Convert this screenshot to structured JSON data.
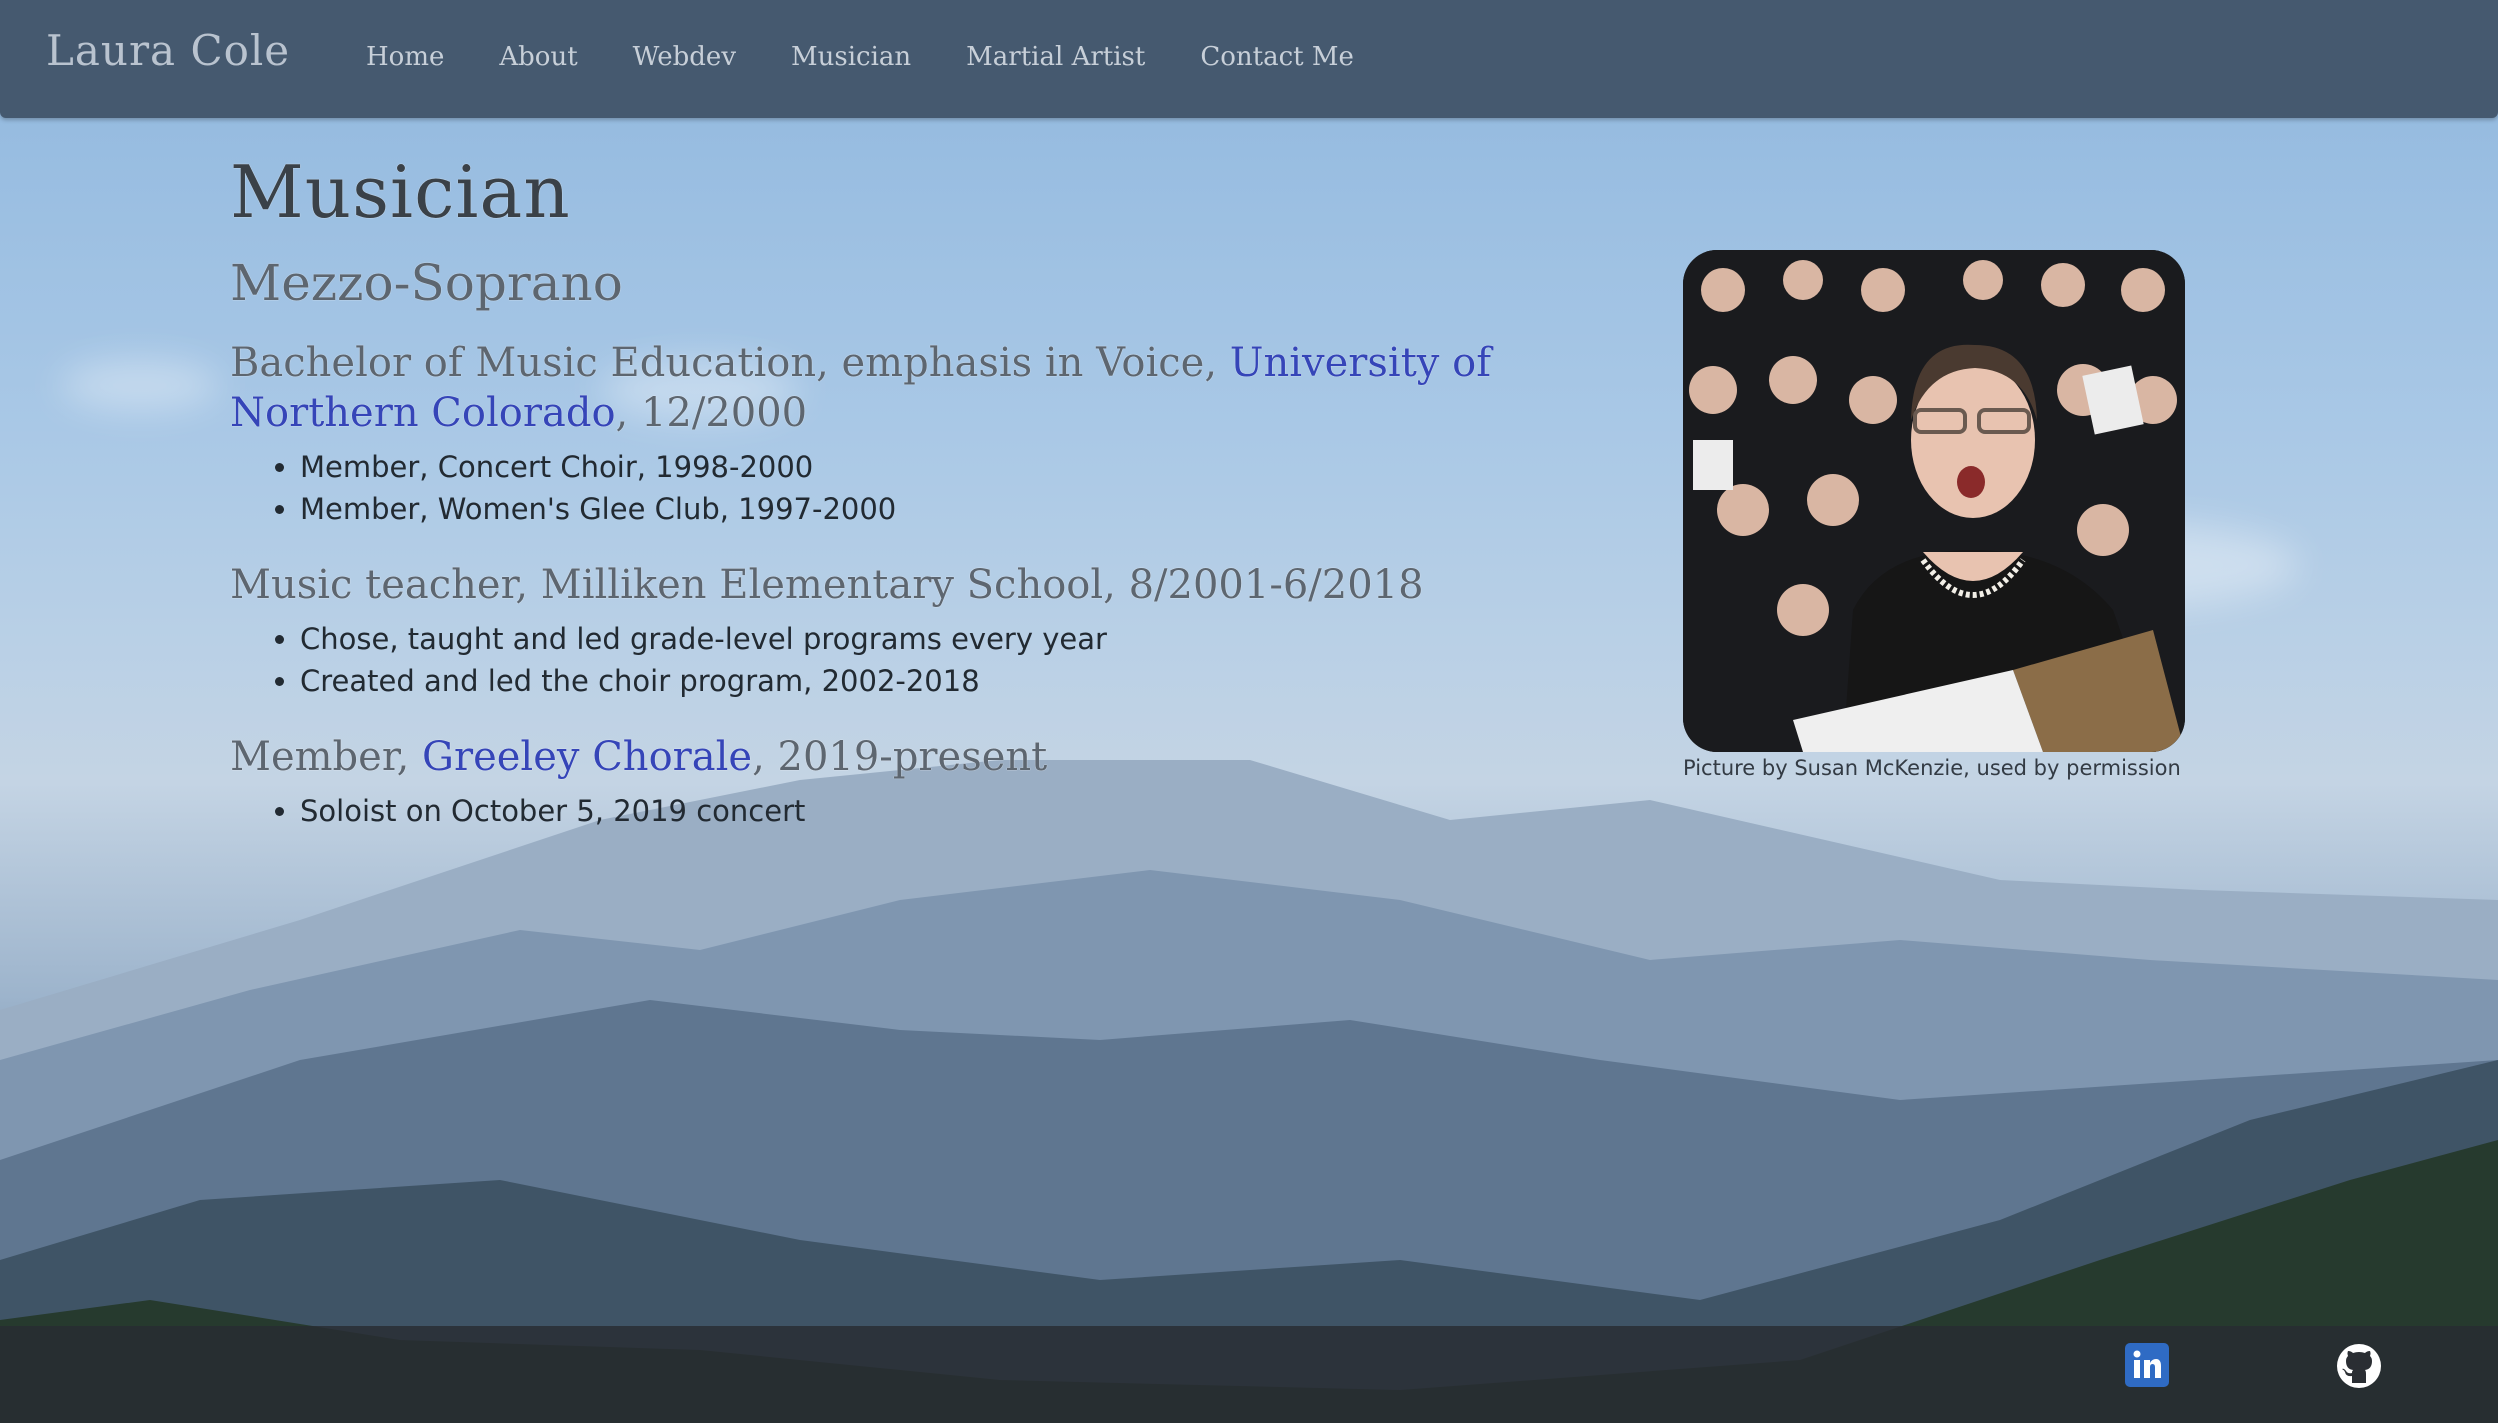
{
  "brand": "Laura Cole",
  "nav": {
    "items": [
      "Home",
      "About",
      "Webdev",
      "Musician",
      "Martial Artist",
      "Contact Me"
    ]
  },
  "page": {
    "title": "Musician",
    "subtitle": "Mezzo-Soprano",
    "sections": [
      {
        "heading_prefix": "Bachelor of Music Education, emphasis in Voice, ",
        "heading_link": "University of Northern Colorado",
        "heading_suffix": ", 12/2000",
        "items": [
          "Member, Concert Choir, 1998-2000",
          "Member, Women's Glee Club, 1997-2000"
        ]
      },
      {
        "heading": "Music teacher, Milliken Elementary School, 8/2001-6/2018",
        "items": [
          "Chose, taught and led grade-level programs every year",
          "Created and led the choir program, 2002-2018"
        ]
      },
      {
        "heading_prefix": "Member, ",
        "heading_link": "Greeley Chorale",
        "heading_suffix": ", 2019-present",
        "items": [
          "Soloist on October 5, 2019 concert"
        ]
      }
    ],
    "photo_caption": "Picture by Susan McKenzie, used by permission"
  },
  "footer": {
    "linkedin_icon": "linkedin-icon",
    "github_icon": "github-icon"
  },
  "colors": {
    "navbar": "#45596f",
    "link": "#3545b8",
    "linkedin": "#2f6bc4"
  }
}
